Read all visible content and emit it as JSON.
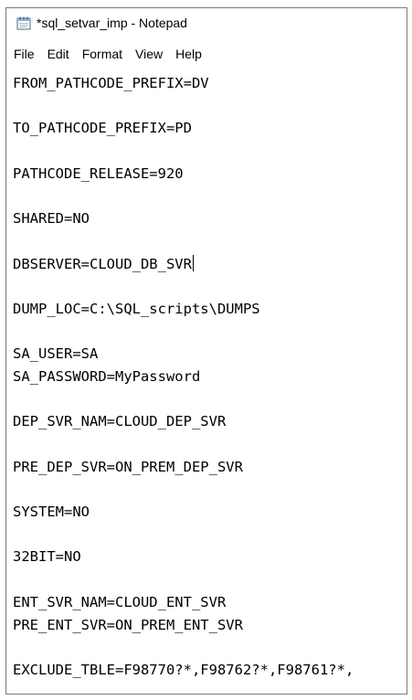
{
  "window": {
    "title": "*sql_setvar_imp - Notepad",
    "icon": "notepad-icon"
  },
  "menu": {
    "items": [
      "File",
      "Edit",
      "Format",
      "View",
      "Help"
    ]
  },
  "editor": {
    "lines": [
      "FROM_PATHCODE_PREFIX=DV",
      "",
      "TO_PATHCODE_PREFIX=PD",
      "",
      "PATHCODE_RELEASE=920",
      "",
      "SHARED=NO",
      "",
      "DBSERVER=CLOUD_DB_SVR",
      "",
      "DUMP_LOC=C:\\SQL_scripts\\DUMPS",
      "",
      "SA_USER=SA",
      "SA_PASSWORD=MyPassword",
      "",
      "DEP_SVR_NAM=CLOUD_DEP_SVR",
      "",
      "PRE_DEP_SVR=ON_PREM_DEP_SVR",
      "",
      "SYSTEM=NO",
      "",
      "32BIT=NO",
      "",
      "ENT_SVR_NAM=CLOUD_ENT_SVR",
      "PRE_ENT_SVR=ON_PREM_ENT_SVR",
      "",
      "EXCLUDE_TBLE=F98770?*,F98762?*,F98761?*,"
    ],
    "caret_line": 8
  }
}
